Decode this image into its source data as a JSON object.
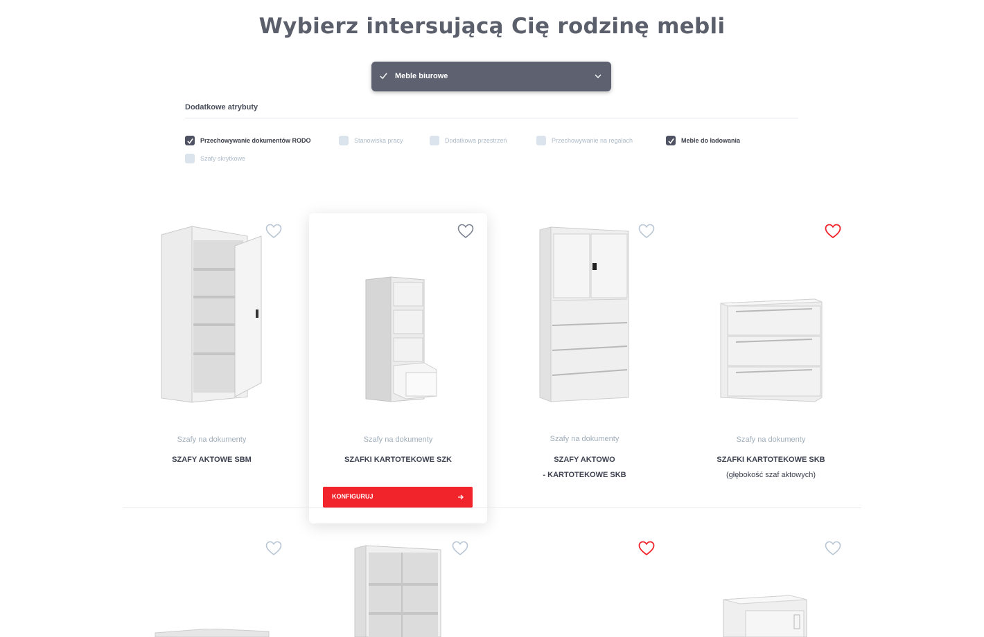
{
  "page": {
    "title": "Wybierz intersującą Cię rodzinę mebli"
  },
  "family_select": {
    "selected": "Meble biurowe"
  },
  "attributes": {
    "title": "Dodatkowe atrybuty",
    "options": [
      {
        "label": "Przechowywanie dokumentów RODO",
        "checked": true
      },
      {
        "label": "Stanowiska pracy",
        "checked": false
      },
      {
        "label": "Dodatkowa przestrzeń",
        "checked": false
      },
      {
        "label": "Przechowywanie na regałach",
        "checked": false
      },
      {
        "label": "Meble do ładowania",
        "checked": true
      },
      {
        "label": "Szafy skrytkowe",
        "checked": false
      }
    ]
  },
  "products": [
    {
      "category": "Szafy na dokumenty",
      "name_line1": "SZAFY AKTOWE SBM",
      "name_line2": "",
      "favorite": false,
      "icon": "open-cabinet-image"
    },
    {
      "category": "Szafy na dokumenty",
      "name_line1": "SZAFKI KARTOTEKOWE SZK",
      "name_line2": "",
      "favorite": false,
      "icon": "filing-cabinet-image",
      "button": "KONFIGURUJ"
    },
    {
      "category": "Szafy na dokumenty",
      "name_line1": "SZAFY AKTOWO",
      "name_line2": "- KARTOTEKOWE SKB",
      "favorite": false,
      "icon": "cabinet-drawers-image"
    },
    {
      "category": "Szafy na dokumenty",
      "name_line1": "SZAFKI KARTOTEKOWE SKB",
      "name_line2": "(głębokość szaf aktowych)",
      "favorite": true,
      "icon": "lateral-file-image"
    }
  ],
  "second_row_favorites": [
    false,
    false,
    true,
    false
  ],
  "colors": {
    "accent": "#f1242c",
    "select_bg": "#5d6170",
    "checkbox_on": "#4e5262",
    "checkbox_off": "#dbe3ec"
  }
}
